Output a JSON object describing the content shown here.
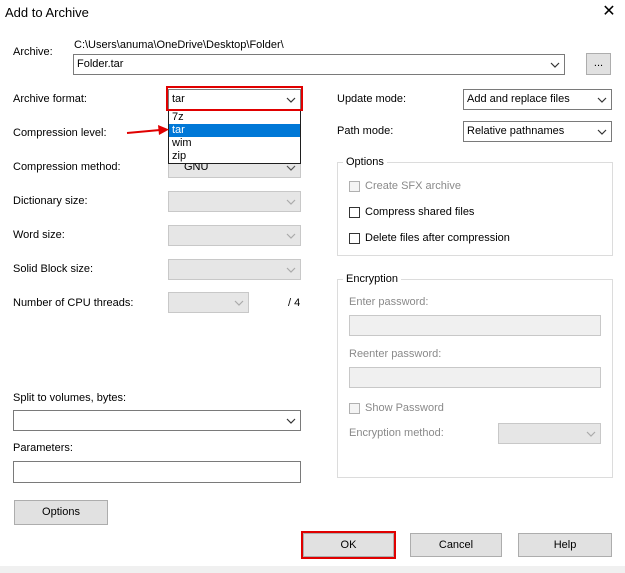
{
  "window": {
    "title": "Add to Archive"
  },
  "archive": {
    "label": "Archive:",
    "path": "C:\\Users\\anuma\\OneDrive\\Desktop\\Folder\\",
    "filename": "Folder.tar",
    "browse_label": "..."
  },
  "left": {
    "archive_format_label": "Archive format:",
    "archive_format_value": "tar",
    "format_options": [
      "7z",
      "tar",
      "wim",
      "zip"
    ],
    "compression_level_label": "Compression level:",
    "compression_method_label": "Compression method:",
    "compression_method_value": "GNU",
    "dictionary_size_label": "Dictionary size:",
    "word_size_label": "Word size:",
    "solid_block_label": "Solid Block size:",
    "cpu_threads_label": "Number of CPU threads:",
    "cpu_threads_total": "/ 4",
    "split_label": "Split to volumes, bytes:",
    "parameters_label": "Parameters:",
    "options_button": "Options"
  },
  "right": {
    "update_mode_label": "Update mode:",
    "update_mode_value": "Add and replace files",
    "path_mode_label": "Path mode:",
    "path_mode_value": "Relative pathnames",
    "options_group": {
      "title": "Options",
      "create_sfx": "Create SFX archive",
      "compress_shared": "Compress shared files",
      "delete_after": "Delete files after compression"
    },
    "encryption_group": {
      "title": "Encryption",
      "enter_password": "Enter password:",
      "reenter_password": "Reenter password:",
      "show_password": "Show Password",
      "encryption_method": "Encryption method:"
    }
  },
  "buttons": {
    "ok": "OK",
    "cancel": "Cancel",
    "help": "Help"
  },
  "colors": {
    "highlight": "#e00000",
    "selection": "#0078d7"
  }
}
